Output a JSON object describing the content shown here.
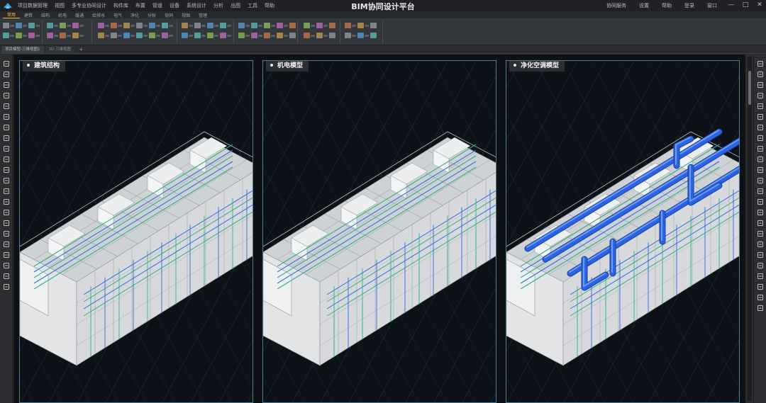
{
  "window": {
    "title": "BIM协同设计平台",
    "menu_left": [
      "项目数据管理",
      "视图",
      "多专业协同设计",
      "构件库",
      "布置",
      "管道",
      "设备",
      "系统设计",
      "分析",
      "出图",
      "工具",
      "帮助"
    ],
    "menu_right": [
      "协同服务",
      "设置",
      "帮助",
      "登录",
      "窗口"
    ],
    "controls": [
      "—",
      "□",
      "✕"
    ]
  },
  "ribbon": {
    "tabs": [
      "常用",
      "建筑",
      "结构",
      "机电",
      "暖通",
      "给排水",
      "电气",
      "净化",
      "分析",
      "协同",
      "视图",
      "管理"
    ]
  },
  "doc_tabs": {
    "items": [
      "项目模型-三维视图1",
      "3D 三维视图"
    ],
    "add": "+"
  },
  "panels": [
    {
      "label": "建筑结构"
    },
    {
      "label": "机电模型"
    },
    {
      "label": "净化空调模型"
    }
  ],
  "colors": {
    "building": "#e2e4e6",
    "pipe_green": "#2fae85",
    "pipe_blue": "#2f6fe0",
    "duct_blue": "#2a63e4",
    "grid": "#2c4a5a"
  }
}
